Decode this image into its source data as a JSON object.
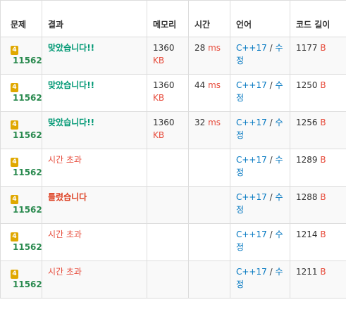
{
  "headers": {
    "problem": "문제",
    "result": "결과",
    "memory": "메모리",
    "time": "시간",
    "language": "언어",
    "code_length": "코드 길이"
  },
  "colors": {
    "accepted": "#009874",
    "tle": "#e74c3c",
    "wrong": "#dd4124",
    "link": "#0076c0",
    "tier": "#e0a800"
  },
  "rows": [
    {
      "tier": "4",
      "problem_id": "11562",
      "result": "맞았습니다!!",
      "result_type": "ok",
      "memory": "1360",
      "memory_unit": "KB",
      "time": "28",
      "time_unit": "ms",
      "language": "C++17",
      "sep": "/",
      "edit": "수정",
      "length": "1177",
      "length_unit": "B"
    },
    {
      "tier": "4",
      "problem_id": "11562",
      "result": "맞았습니다!!",
      "result_type": "ok",
      "memory": "1360",
      "memory_unit": "KB",
      "time": "44",
      "time_unit": "ms",
      "language": "C++17",
      "sep": "/",
      "edit": "수정",
      "length": "1250",
      "length_unit": "B"
    },
    {
      "tier": "4",
      "problem_id": "11562",
      "result": "맞았습니다!!",
      "result_type": "ok",
      "memory": "1360",
      "memory_unit": "KB",
      "time": "32",
      "time_unit": "ms",
      "language": "C++17",
      "sep": "/",
      "edit": "수정",
      "length": "1256",
      "length_unit": "B"
    },
    {
      "tier": "4",
      "problem_id": "11562",
      "result": "시간 초과",
      "result_type": "tle",
      "memory": "",
      "memory_unit": "",
      "time": "",
      "time_unit": "",
      "language": "C++17",
      "sep": "/",
      "edit": "수정",
      "length": "1289",
      "length_unit": "B"
    },
    {
      "tier": "4",
      "problem_id": "11562",
      "result": "틀렸습니다",
      "result_type": "wa",
      "memory": "",
      "memory_unit": "",
      "time": "",
      "time_unit": "",
      "language": "C++17",
      "sep": "/",
      "edit": "수정",
      "length": "1288",
      "length_unit": "B"
    },
    {
      "tier": "4",
      "problem_id": "11562",
      "result": "시간 초과",
      "result_type": "tle",
      "memory": "",
      "memory_unit": "",
      "time": "",
      "time_unit": "",
      "language": "C++17",
      "sep": "/",
      "edit": "수정",
      "length": "1214",
      "length_unit": "B"
    },
    {
      "tier": "4",
      "problem_id": "11562",
      "result": "시간 초과",
      "result_type": "tle",
      "memory": "",
      "memory_unit": "",
      "time": "",
      "time_unit": "",
      "language": "C++17",
      "sep": "/",
      "edit": "수정",
      "length": "1211",
      "length_unit": "B"
    }
  ]
}
